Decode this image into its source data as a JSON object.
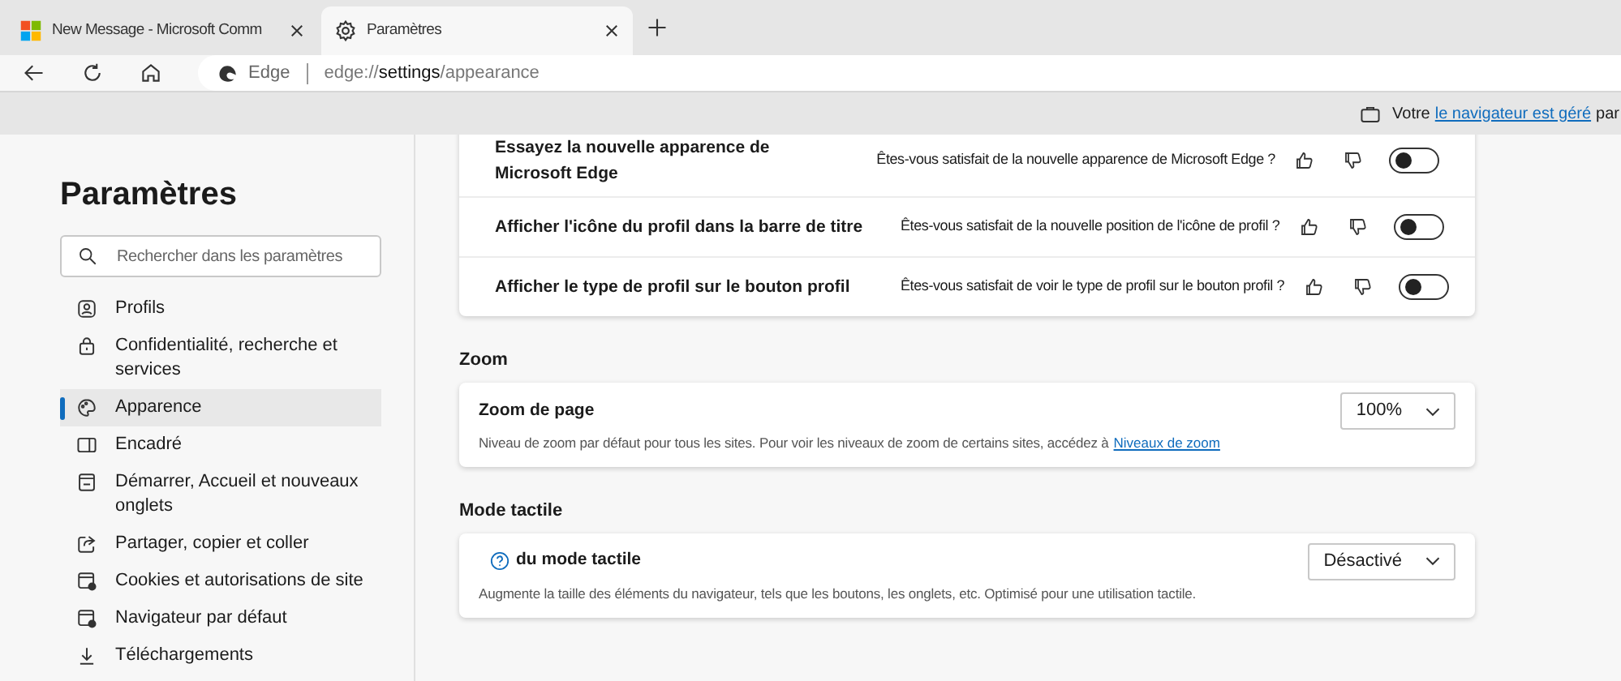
{
  "tabs": [
    {
      "title": "New Message - Microsoft Comm",
      "selected": false
    },
    {
      "title": "Paramètres",
      "selected": true
    }
  ],
  "address_bar": {
    "site": "Edge",
    "url_prefix": "edge://",
    "url_host": "settings",
    "url_path": "/appearance"
  },
  "info_bar": {
    "prefix": "Votre",
    "link": "le navigateur est géré",
    "suffix": "par"
  },
  "sidebar": {
    "title": "Paramètres",
    "search": {
      "placeholder": "Rechercher dans les paramètres"
    },
    "items": [
      {
        "label": "Profils",
        "selected": false
      },
      {
        "label": "Confidentialité, recherche et services",
        "selected": false
      },
      {
        "label": "Apparence",
        "selected": true
      },
      {
        "label": "Encadré",
        "selected": false
      },
      {
        "label": "Démarrer, Accueil et nouveaux onglets",
        "selected": false
      },
      {
        "label": "Partager, copier et coller",
        "selected": false
      },
      {
        "label": "Cookies et autorisations de site",
        "selected": false
      },
      {
        "label": "Navigateur par défaut",
        "selected": false
      },
      {
        "label": "Téléchargements",
        "selected": false
      }
    ]
  },
  "feature_rows": [
    {
      "title": "Essayez la nouvelle apparence de Microsoft Edge",
      "question": "Êtes-vous satisfait de la nouvelle apparence de Microsoft Edge ?",
      "on": false
    },
    {
      "title": "Afficher l'icône du profil dans la barre de titre",
      "question": "Êtes-vous satisfait de la nouvelle position de l'icône de profil ?",
      "on": false
    },
    {
      "title": "Afficher le type de profil sur le bouton profil",
      "question": "Êtes-vous satisfait de voir le type de profil sur le bouton profil ?",
      "on": false
    }
  ],
  "sections": [
    {
      "heading": "Zoom",
      "title": "Zoom de page",
      "help_icon": false,
      "description": "Niveau de zoom par défaut pour tous les sites. Pour voir les niveaux de zoom de certains sites, accédez à",
      "link": "Niveaux de zoom",
      "value": "100%"
    },
    {
      "heading": "Mode tactile",
      "title": "du mode tactile",
      "help_icon": true,
      "description": "Augmente la taille des éléments du navigateur, tels que les boutons, les onglets, etc. Optimisé pour une utilisation tactile.",
      "value": "Désactivé"
    }
  ]
}
